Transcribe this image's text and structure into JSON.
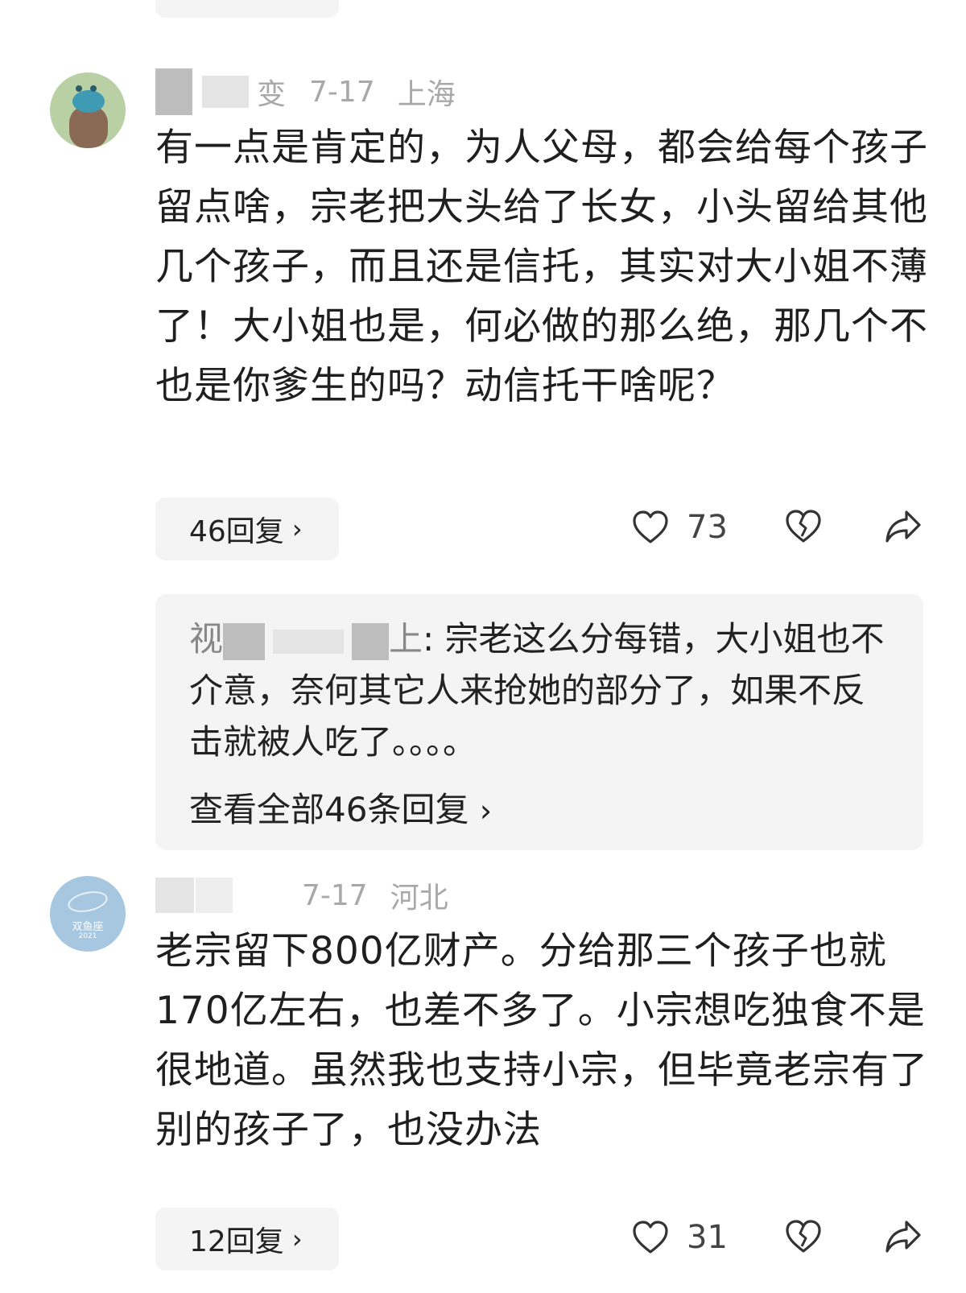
{
  "comments": [
    {
      "username_tail": "变",
      "date": "7-17",
      "location": "上海",
      "text": "有一点是肯定的，为人父母，都会给每个孩子留点啥，宗老把大头给了长女，小头留给其他几个孩子，而且还是信托，其实对大小姐不薄了！大小姐也是，何必做的那么绝，那几个不也是你爹生的吗？动信托干啥呢？",
      "reply_button": "46回复",
      "likes": "73",
      "top_reply": {
        "name": "视",
        "name_end": "上",
        "text": ": 宗老这么分每错，大小姐也不介意，奈何其它人来抢她的部分了，如果不反击就被人吃了。。。。",
        "view_all": "查看全部46条回复"
      }
    },
    {
      "avatar_text": "双鱼座",
      "avatar_year": "2021",
      "date": "7-17",
      "location": "河北",
      "text": "老宗留下800亿财产。分给那三个孩子也就170亿左右，也差不多了。小宗想吃独食不是很地道。虽然我也支持小宗，但毕竟老宗有了别的孩子了，也没办法",
      "reply_button": "12回复",
      "likes": "31"
    }
  ],
  "icons": {
    "like": "heart-outline-icon",
    "dislike": "broken-heart-icon",
    "share": "share-arrow-icon",
    "chevron": "chevron-right-icon"
  }
}
